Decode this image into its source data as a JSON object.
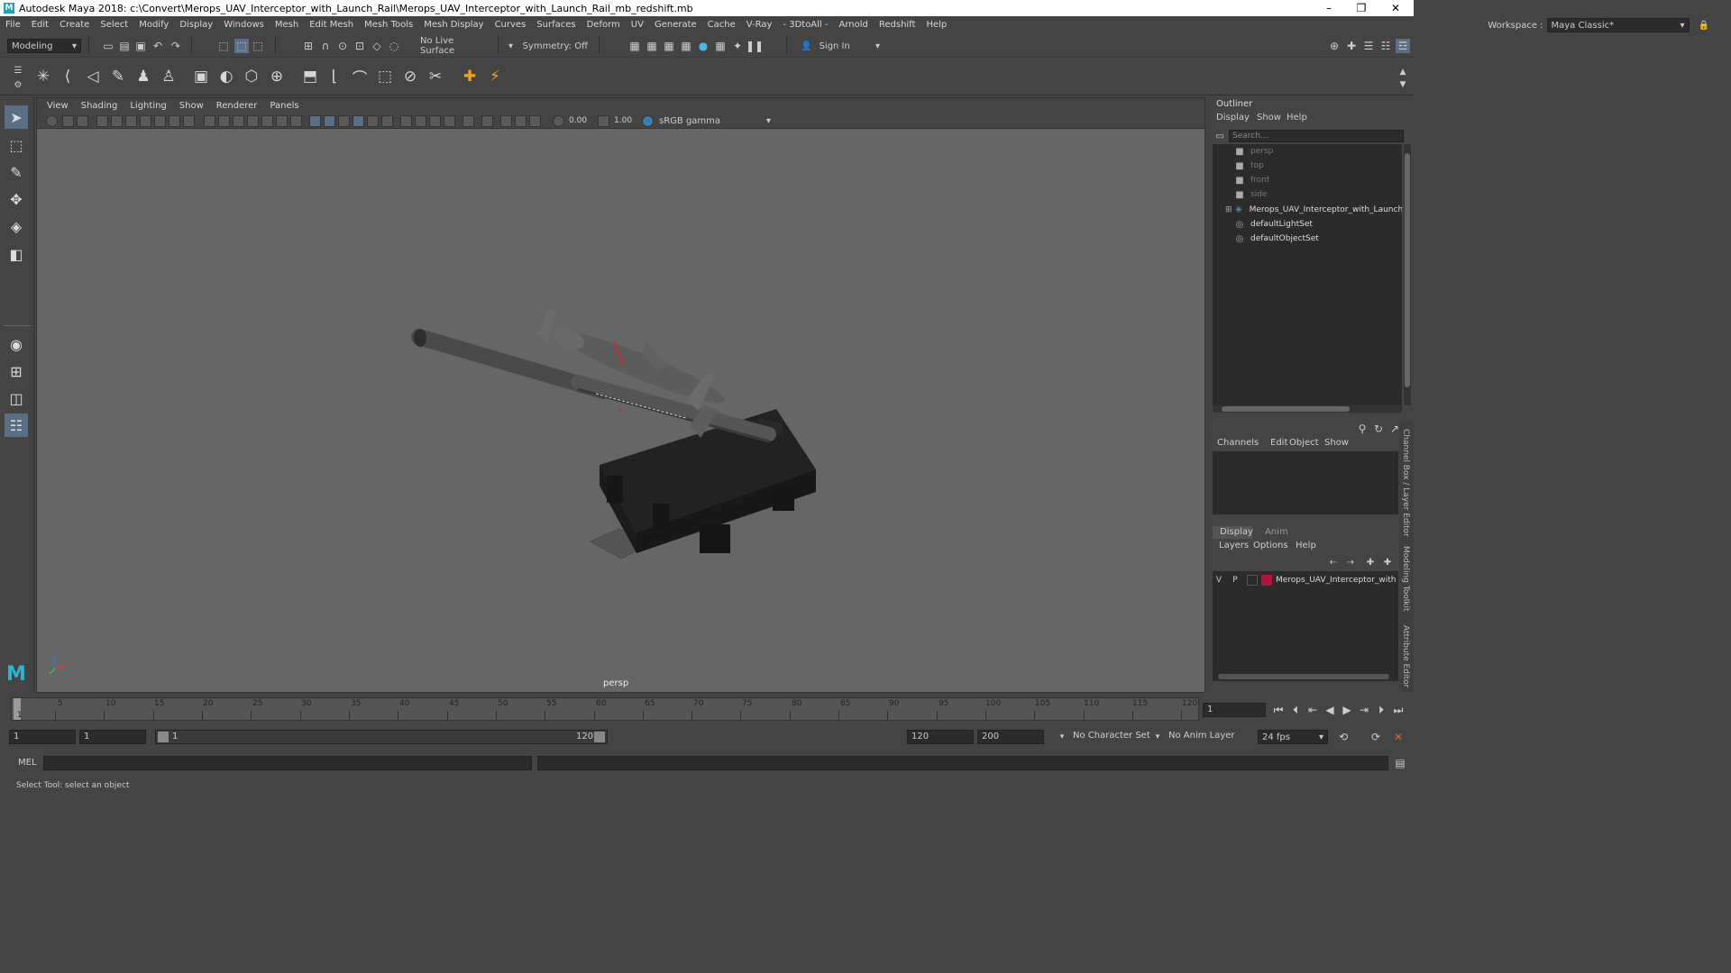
{
  "window": {
    "title": "Autodesk Maya 2018: c:\\Convert\\Merops_UAV_Interceptor_with_Launch_Rail\\Merops_UAV_Interceptor_with_Launch_Rail_mb_redshift.mb",
    "logo_letter": "M",
    "controls": [
      "–",
      "❐",
      "✕"
    ]
  },
  "menubar": {
    "items": [
      "File",
      "Edit",
      "Create",
      "Select",
      "Modify",
      "Display",
      "Windows",
      "Mesh",
      "Edit Mesh",
      "Mesh Tools",
      "Mesh Display",
      "Curves",
      "Surfaces",
      "Deform",
      "UV",
      "Generate",
      "Cache",
      "V-Ray",
      "- 3DtoAll -",
      "Arnold",
      "Redshift",
      "Help"
    ],
    "workspace_label": "Workspace :",
    "workspace_value": "Maya Classic*"
  },
  "statusline": {
    "mode": "Modeling",
    "live_surface": "No Live Surface",
    "symmetry": "Symmetry: Off",
    "sign_in": "Sign In"
  },
  "viewport": {
    "menu": [
      "View",
      "Shading",
      "Lighting",
      "Show",
      "Renderer",
      "Panels"
    ],
    "exposure": "0.00",
    "gamma": "1.00",
    "color_space": "sRGB gamma",
    "camera_label": "persp"
  },
  "outliner": {
    "title": "Outliner",
    "menu": [
      "Display",
      "Show",
      "Help"
    ],
    "search_placeholder": "Search...",
    "items": [
      {
        "label": "persp",
        "icon": "camera-icon",
        "dim": true
      },
      {
        "label": "top",
        "icon": "camera-icon",
        "dim": true
      },
      {
        "label": "front",
        "icon": "camera-icon",
        "dim": true
      },
      {
        "label": "side",
        "icon": "camera-icon",
        "dim": true
      },
      {
        "label": "Merops_UAV_Interceptor_with_Launch_R",
        "icon": "group-icon",
        "dim": false
      },
      {
        "label": "defaultLightSet",
        "icon": "set-icon",
        "dim": false
      },
      {
        "label": "defaultObjectSet",
        "icon": "set-icon",
        "dim": false
      }
    ]
  },
  "channelbox": {
    "menu": [
      "Channels",
      "Edit",
      "Object",
      "Show"
    ]
  },
  "layereditor": {
    "tabs": [
      "Display",
      "Anim"
    ],
    "menu": [
      "Layers",
      "Options",
      "Help"
    ],
    "layer": {
      "v": "V",
      "p": "P",
      "name": "Merops_UAV_Interceptor_with",
      "color": "#b0143c"
    }
  },
  "sidetabs": [
    "Channel Box / Layer Editor",
    "Modeling Toolkit",
    "Attribute Editor"
  ],
  "timeline": {
    "labels": [
      "1",
      "5",
      "10",
      "15",
      "20",
      "25",
      "30",
      "35",
      "40",
      "45",
      "50",
      "55",
      "60",
      "65",
      "70",
      "75",
      "80",
      "85",
      "90",
      "95",
      "100",
      "105",
      "110",
      "115",
      "120"
    ],
    "current_frame": "1"
  },
  "range": {
    "start": "1",
    "playback_start": "1",
    "slider_start": "1",
    "slider_end": "120",
    "playback_end": "120",
    "end": "200",
    "character_set": "No Character Set",
    "anim_layer": "No Anim Layer",
    "fps": "24 fps"
  },
  "cmdline": {
    "label": "MEL"
  },
  "helpline": {
    "text": "Select Tool: select an object"
  }
}
